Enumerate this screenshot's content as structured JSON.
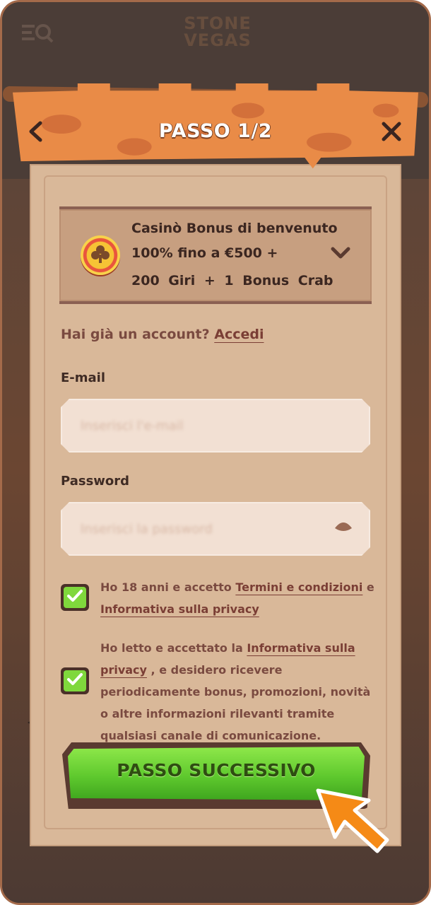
{
  "background": {
    "logo_line1": "STONE",
    "logo_line2": "VEGAS"
  },
  "header": {
    "title": "PASSO 1/2",
    "back_icon": "chevron-left-icon",
    "close_icon": "close-icon"
  },
  "bonus": {
    "line1": "Casinò Bonus di benvenuto",
    "line2": "100% fino a €500 +",
    "line3": "200 Giri + 1 Bonus Crab",
    "icon": "casino-chip-icon",
    "expand_icon": "chevron-down-icon"
  },
  "login": {
    "prompt": "Hai già un account?",
    "link": "Accedi"
  },
  "form": {
    "email_label": "E-mail",
    "email_placeholder": "Inserisci l'e-mail",
    "email_value": "",
    "password_label": "Password",
    "password_placeholder": "Inserisci la password",
    "password_value": "",
    "password_toggle_icon": "eye-icon"
  },
  "consents": [
    {
      "checked": true,
      "text_before": "Ho 18 anni e accetto ",
      "link1": "Termini e condizioni",
      "text_middle": " e ",
      "link2": "Informativa sulla privacy"
    },
    {
      "checked": true,
      "text_before": "Ho letto e accettato la ",
      "link1": "Informativa sulla privacy",
      "text_after": " , e desidero ricevere periodicamente bonus, promozioni, novità o altre informazioni rilevanti tramite qualsiasi canale di comunicazione."
    }
  ],
  "cta": {
    "label": "PASSO SUCCESSIVO"
  },
  "colors": {
    "banner": "#e98b47",
    "panel": "#d9b899",
    "cta_green": "#5fc92e",
    "pointer": "#f58a16",
    "checkbox_green": "#7fd83c"
  }
}
